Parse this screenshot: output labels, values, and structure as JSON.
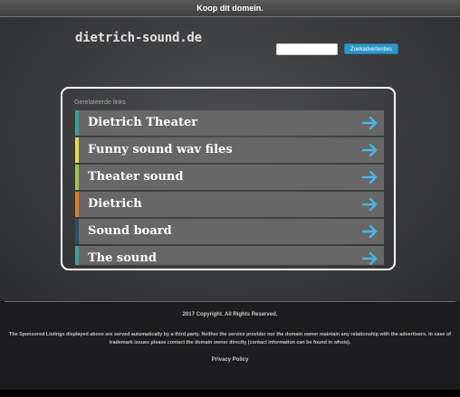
{
  "topbar": {
    "label": "Koop dit domein."
  },
  "header": {
    "logo": "dietrich-sound.de",
    "search": {
      "placeholder": "",
      "button_label": "Zoekadvertenties",
      "button_color": "#2e97c8"
    }
  },
  "links": {
    "heading": "Gerelateerde links",
    "items": [
      {
        "label": "Dietrich Theater",
        "stripe_color": "#3aa49a",
        "icon": "arrow-right-icon"
      },
      {
        "label": "Funny sound wav files",
        "stripe_color": "#e6dc3a",
        "icon": "arrow-right-icon"
      },
      {
        "label": "Theater sound",
        "stripe_color": "#9acb3f",
        "icon": "arrow-right-icon"
      },
      {
        "label": "Dietrich",
        "stripe_color": "#e07b27",
        "icon": "arrow-right-icon"
      },
      {
        "label": "Sound board",
        "stripe_color": "#2a4e66",
        "icon": "arrow-right-icon"
      },
      {
        "label": "The sound",
        "stripe_color": "#3aa49a",
        "icon": "arrow-right-icon"
      }
    ],
    "arrow_color": "#4ab3e4"
  },
  "footer": {
    "copyright": "2017 Copyright. All Rights Reserved.",
    "disclaimer": "The Sponsored Listings displayed above are served automatically by a third party. Neither the service provider nor the domain owner maintain any relationship with the advertisers. In case of trademark issues please contact the domain owner directly (contact information can be found in whois).",
    "privacy": "Privacy Policy"
  }
}
